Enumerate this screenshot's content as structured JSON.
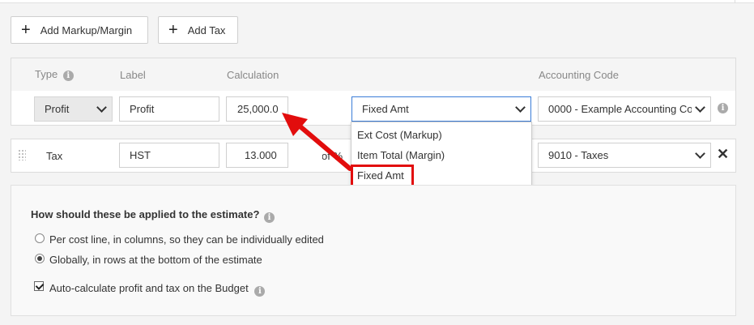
{
  "toolbar": {
    "add_markup_label": "Add Markup/Margin",
    "add_tax_label": "Add Tax"
  },
  "table_header": {
    "type": "Type",
    "label": "Label",
    "calculation": "Calculation",
    "accounting_code": "Accounting Code"
  },
  "row_profit": {
    "type": "Profit",
    "label": "Profit",
    "calculation": "25,000.0",
    "method": "Fixed Amt",
    "accounting_code": "0000 - Example Accounting Code"
  },
  "row_tax": {
    "type": "Tax",
    "label": "HST",
    "calculation": "13.000",
    "of_text": "% of",
    "accounting_code": "9010 - Taxes"
  },
  "method_dropdown": {
    "options": [
      "Ext Cost (Markup)",
      "Item Total (Margin)",
      "Fixed Amt"
    ],
    "selected": "Fixed Amt"
  },
  "settings": {
    "question": "How should these be applied to the estimate?",
    "option_per_line": "Per cost line, in columns, so they can be individually edited",
    "option_global": "Globally, in rows at the bottom of the estimate",
    "selected_option": "Globally, in rows at the bottom of the estimate",
    "auto_calc_label": "Auto-calculate profit and tax on the Budget",
    "auto_calc_checked": true
  },
  "colors": {
    "annotation_red": "#e20d0d",
    "panel_bg": "#ffffff",
    "page_bg": "#f4f4f4"
  },
  "icons": [
    "plus-icon",
    "info-icon",
    "chevron-down-icon",
    "drag-handle-icon",
    "close-icon",
    "annotation-arrow"
  ]
}
